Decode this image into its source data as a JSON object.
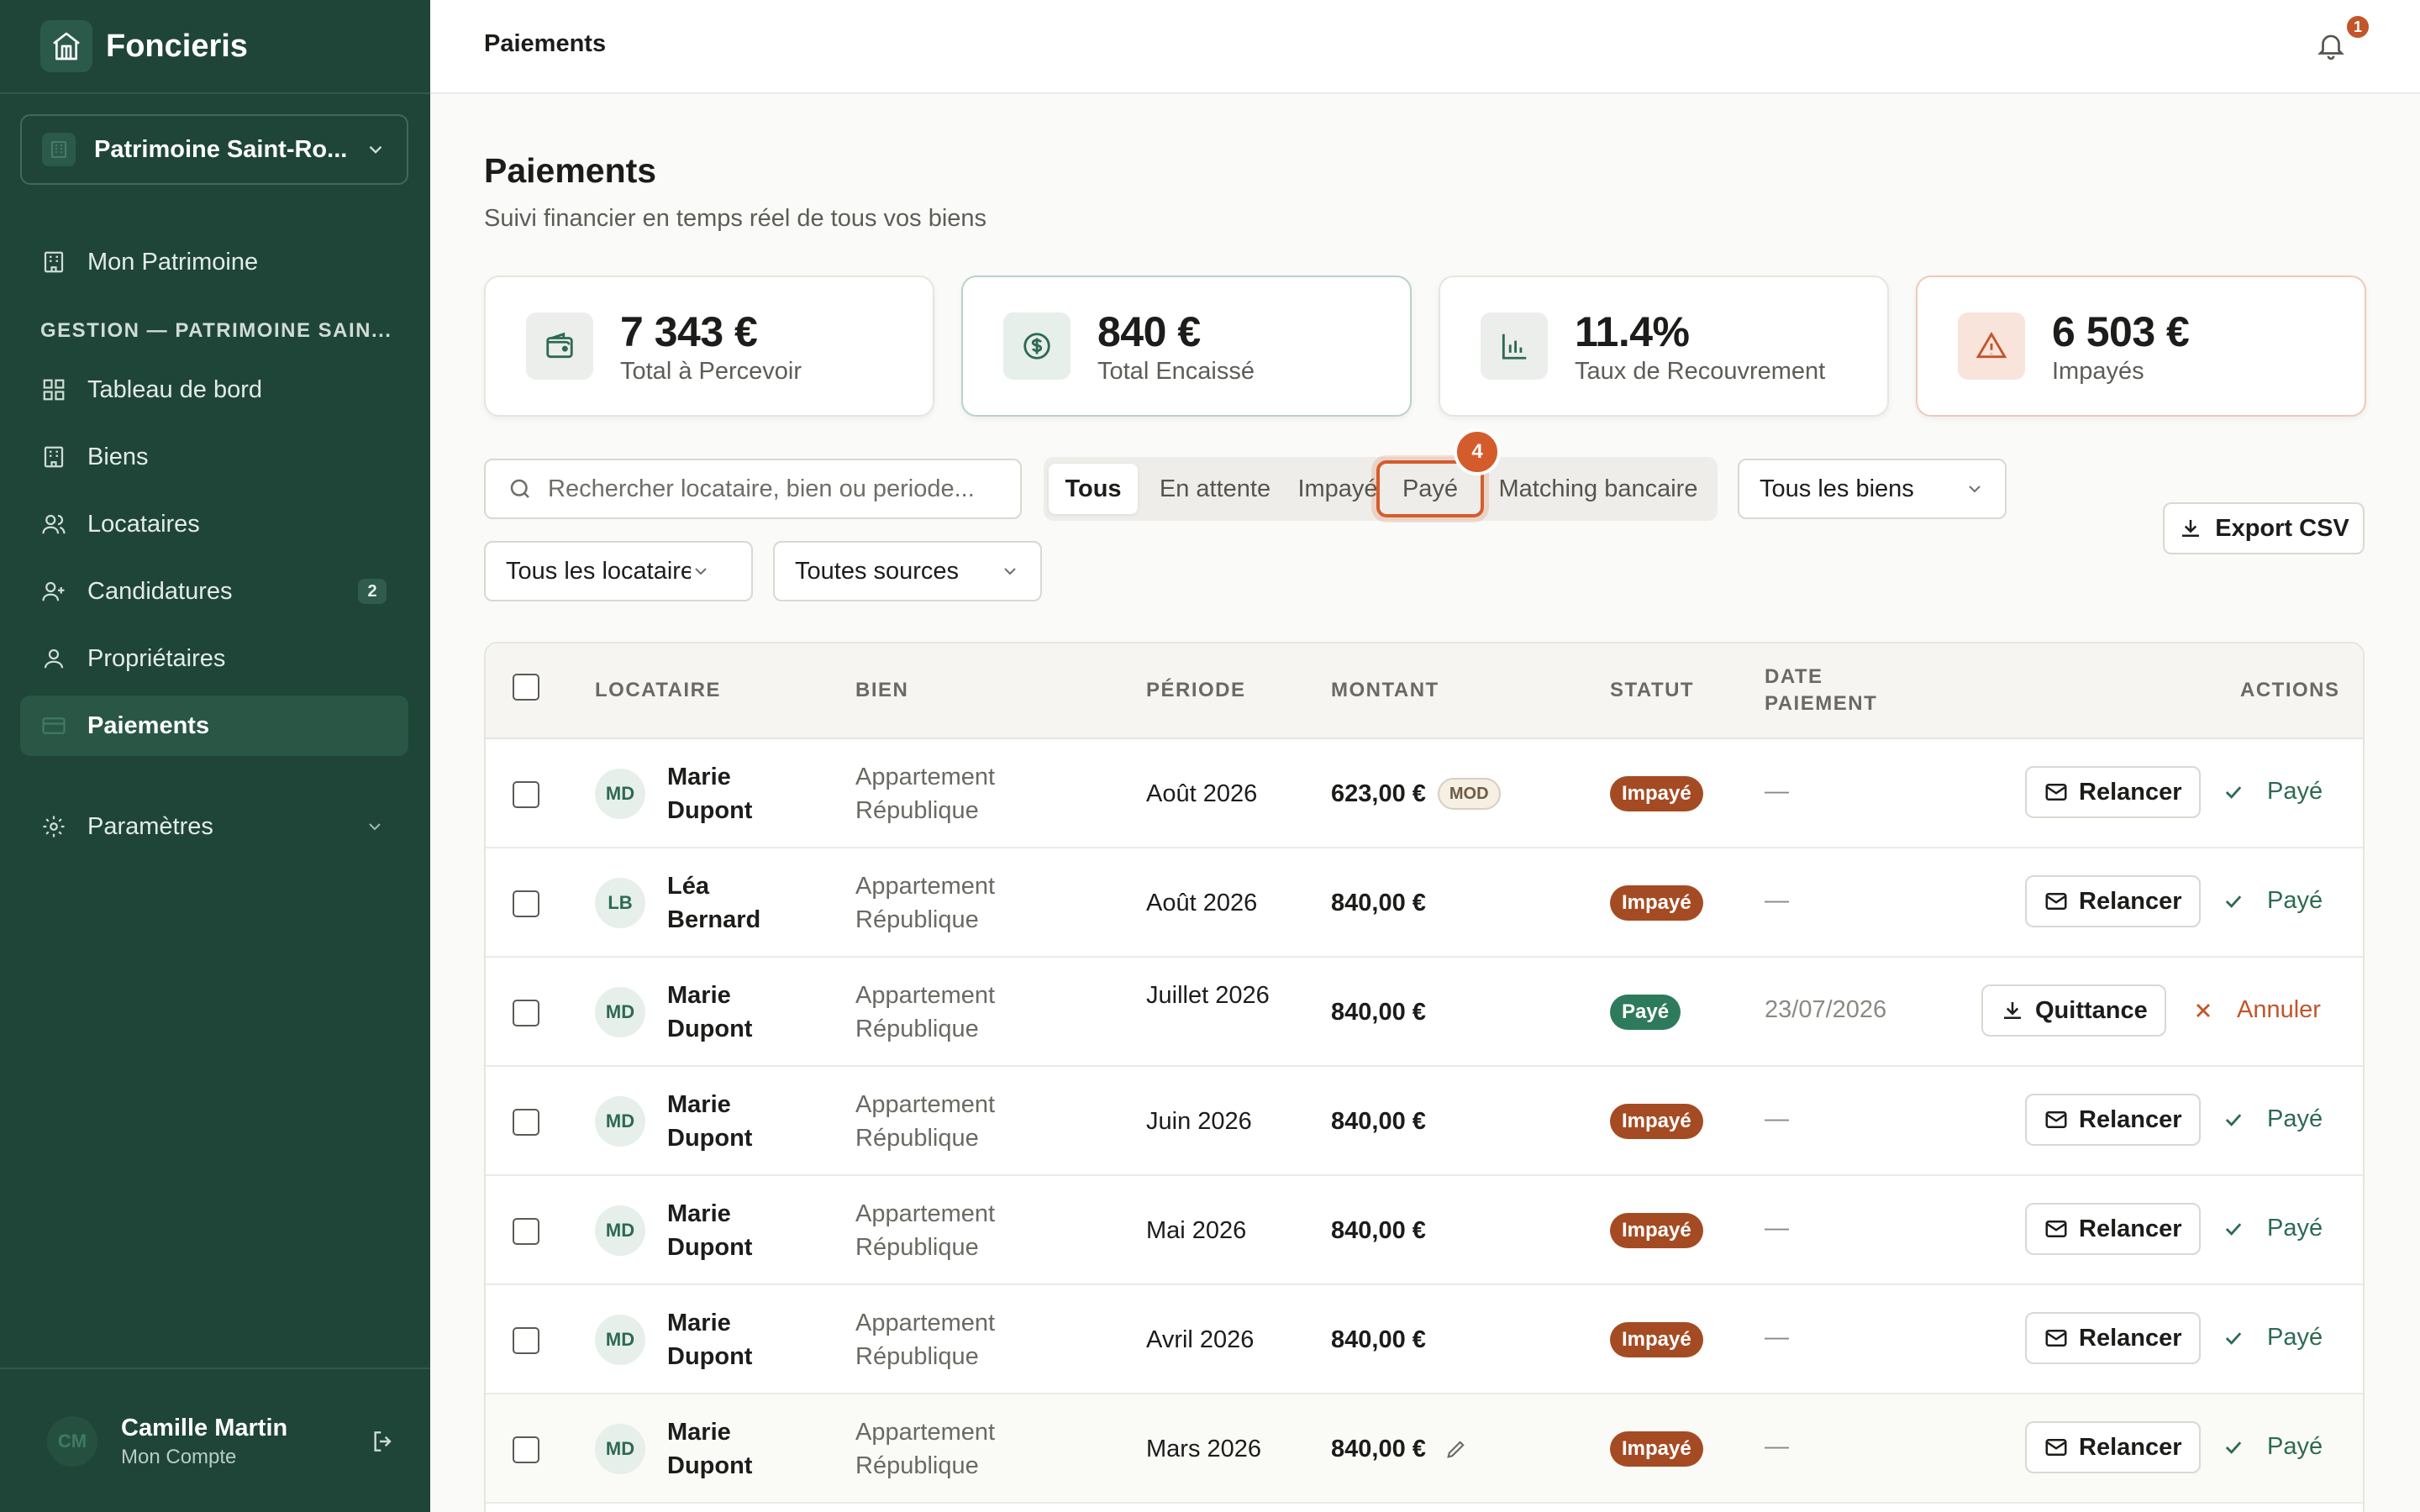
{
  "app": {
    "name": "Foncieris"
  },
  "sidebar": {
    "org": "Patrimoine Saint-Ro...",
    "home": "Mon Patrimoine",
    "section": "GESTION — PATRIMOINE SAIN...",
    "items": [
      {
        "label": "Tableau de bord",
        "icon": "dashboard-icon"
      },
      {
        "label": "Biens",
        "icon": "building-icon"
      },
      {
        "label": "Locataires",
        "icon": "users-icon"
      },
      {
        "label": "Candidatures",
        "icon": "user-plus-icon",
        "badge": "2"
      },
      {
        "label": "Propriétaires",
        "icon": "user-icon"
      },
      {
        "label": "Paiements",
        "icon": "card-icon",
        "active": true
      }
    ],
    "settings": "Paramètres",
    "account": {
      "initials": "CM",
      "name": "Camille Martin",
      "sub": "Mon Compte"
    }
  },
  "topbar": {
    "title": "Paiements",
    "notifications": "1"
  },
  "page": {
    "title": "Paiements",
    "subtitle": "Suivi financier en temps réel de tous vos biens"
  },
  "stats": [
    {
      "value": "7 343 €",
      "label": "Total à Percevoir",
      "icon": "wallet-icon"
    },
    {
      "value": "840 €",
      "label": "Total Encaissé",
      "icon": "dollar-icon"
    },
    {
      "value": "11.4%",
      "label": "Taux de Recouvrement",
      "icon": "bar-chart-icon"
    },
    {
      "value": "6 503 €",
      "label": "Impayés",
      "icon": "warning-icon"
    }
  ],
  "filters": {
    "search_placeholder": "Rechercher locataire, bien ou periode...",
    "segments": [
      "Tous",
      "En attente",
      "Impayé",
      "Payé",
      "Matching bancaire"
    ],
    "active_segment": "Tous",
    "highlight_badge": "4",
    "biens": "Tous les biens",
    "locataires": "Tous les locataires",
    "sources": "Toutes sources",
    "export": "Export CSV"
  },
  "table": {
    "headers": {
      "locataire": "LOCATAIRE",
      "bien": "BIEN",
      "periode": "PÉRIODE",
      "montant": "MONTANT",
      "statut": "STATUT",
      "date1": "DATE",
      "date2": "PAIEMENT",
      "actions": "ACTIONS"
    },
    "rows": [
      {
        "initials": "MD",
        "name": "Marie Dupont",
        "bien": "Appartement République",
        "periode": "Août 2026",
        "montant": "623,00 €",
        "tag": "MOD",
        "status": "Impayé",
        "date": "—",
        "action": "Relancer",
        "secondary": "Payé"
      },
      {
        "initials": "LB",
        "name": "Léa Bernard",
        "bien": "Appartement République",
        "periode": "Août 2026",
        "montant": "840,00 €",
        "status": "Impayé",
        "date": "—",
        "action": "Relancer",
        "secondary": "Payé"
      },
      {
        "initials": "MD",
        "name": "Marie Dupont",
        "bien": "Appartement République",
        "periode": "Juillet 2026",
        "montant": "840,00 €",
        "status": "Payé",
        "date": "23/07/2026",
        "action": "Quittance",
        "secondary": "Annuler"
      },
      {
        "initials": "MD",
        "name": "Marie Dupont",
        "bien": "Appartement République",
        "periode": "Juin 2026",
        "montant": "840,00 €",
        "status": "Impayé",
        "date": "—",
        "action": "Relancer",
        "secondary": "Payé"
      },
      {
        "initials": "MD",
        "name": "Marie Dupont",
        "bien": "Appartement République",
        "periode": "Mai 2026",
        "montant": "840,00 €",
        "status": "Impayé",
        "date": "—",
        "action": "Relancer",
        "secondary": "Payé"
      },
      {
        "initials": "MD",
        "name": "Marie Dupont",
        "bien": "Appartement République",
        "periode": "Avril 2026",
        "montant": "840,00 €",
        "status": "Impayé",
        "date": "—",
        "action": "Relancer",
        "secondary": "Payé"
      },
      {
        "initials": "MD",
        "name": "Marie Dupont",
        "bien": "Appartement République",
        "periode": "Mars 2026",
        "montant": "840,00 €",
        "status": "Impayé",
        "date": "—",
        "action": "Relancer",
        "secondary": "Payé",
        "editable": true
      }
    ]
  },
  "colors": {
    "sidebar": "#1e4538",
    "accent": "#d45c2c",
    "paid": "#2d7a5c",
    "unpaid": "#a54b23"
  }
}
